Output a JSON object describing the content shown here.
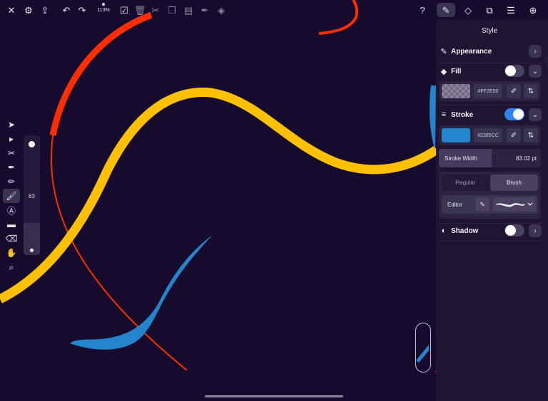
{
  "toolbar": {
    "zoom": "113%",
    "icons": [
      "close-icon",
      "settings-icon",
      "share-icon",
      "undo-icon",
      "redo-icon",
      "select-all-icon",
      "trash-icon",
      "cut-icon",
      "copy-icon",
      "paste-icon",
      "pen-style-icon",
      "fill-style-icon"
    ],
    "right_icons": [
      "help-icon",
      "style-icon",
      "shape-icon",
      "boolean-icon",
      "layers-icon",
      "add-icon"
    ],
    "help_label": "?"
  },
  "tools": [
    "select-icon",
    "direct-select-icon",
    "scissors-icon",
    "pen-icon",
    "pencil-icon",
    "brush-icon",
    "text-icon",
    "rectangle-icon",
    "eraser-icon",
    "hand-icon",
    "zoom-icon"
  ],
  "brush_size": "83",
  "style_panel": {
    "title": "Style",
    "appearance": {
      "label": "Appearance"
    },
    "fill": {
      "label": "Fill",
      "enabled": false,
      "hex": "#FF2E00"
    },
    "stroke": {
      "label": "Stroke",
      "enabled": true,
      "hex": "#2385CC",
      "color": "#2385cc"
    },
    "stroke_width": {
      "label": "Stroke Width",
      "value": "83.02 pt"
    },
    "brush_mode": {
      "options": [
        "Regular",
        "Brush"
      ],
      "selected": "Brush"
    },
    "editor": {
      "label": "Editor"
    },
    "shadow": {
      "label": "Shadow",
      "enabled": false
    }
  },
  "colors": {
    "background": "#170b2d",
    "red": "#ff2e00",
    "yellow": "#ffc000",
    "blue": "#2385cc",
    "accent": "#2a86ec"
  }
}
